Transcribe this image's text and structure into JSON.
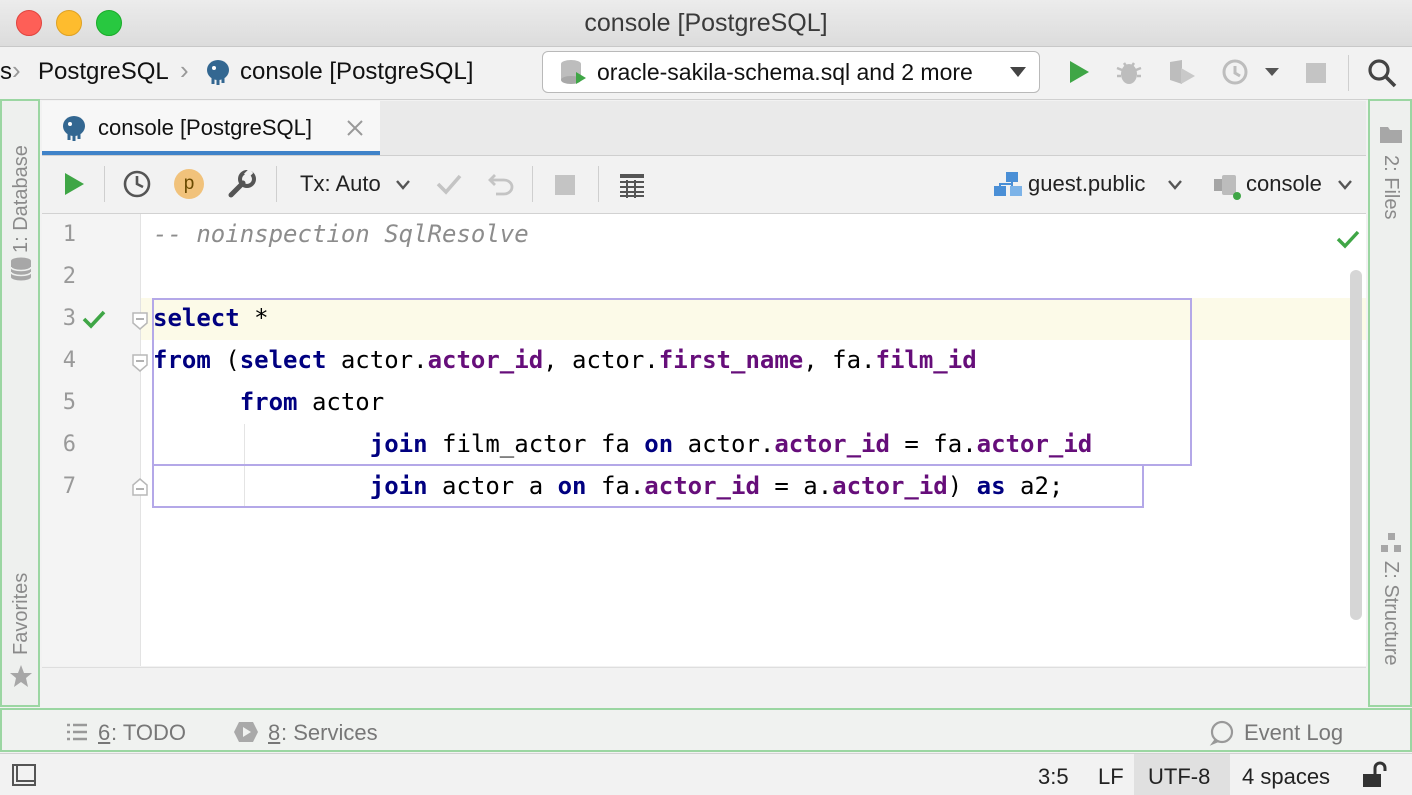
{
  "window": {
    "title": "console [PostgreSQL]"
  },
  "navbar": {
    "crumb_cut": "s",
    "crumb_db": "PostgreSQL",
    "crumb_console": "console [PostgreSQL]",
    "run_config": "oracle-sakila-schema.sql and 2 more"
  },
  "left_panel": {
    "database_label": "1: Database",
    "favorites_label": "Favorites"
  },
  "right_panel": {
    "files_label": "2: Files",
    "structure_label": "Z: Structure"
  },
  "tab": {
    "label": "console [PostgreSQL]"
  },
  "toolbar": {
    "tx_mode": "Tx: Auto",
    "p_badge": "p",
    "schema": "guest.public",
    "session": "console"
  },
  "editor": {
    "line_numbers": [
      "1",
      "2",
      "3",
      "4",
      "5",
      "6",
      "7"
    ],
    "lines": [
      [
        {
          "t": "-- noinspection SqlResolve",
          "c": "cmt"
        }
      ],
      [],
      [
        {
          "t": "select",
          "c": "kw"
        },
        {
          "t": " *",
          "c": ""
        }
      ],
      [
        {
          "t": "from",
          "c": "kw"
        },
        {
          "t": " (",
          "c": ""
        },
        {
          "t": "select",
          "c": "kw"
        },
        {
          "t": " actor.",
          "c": ""
        },
        {
          "t": "actor_id",
          "c": "fld"
        },
        {
          "t": ", actor.",
          "c": ""
        },
        {
          "t": "first_name",
          "c": "fld"
        },
        {
          "t": ", fa.",
          "c": ""
        },
        {
          "t": "film_id",
          "c": "fld"
        }
      ],
      [
        {
          "t": "      ",
          "c": ""
        },
        {
          "t": "from",
          "c": "kw"
        },
        {
          "t": " actor",
          "c": ""
        }
      ],
      [
        {
          "t": "               ",
          "c": ""
        },
        {
          "t": "join",
          "c": "kw"
        },
        {
          "t": " film_actor fa ",
          "c": ""
        },
        {
          "t": "on",
          "c": "kw"
        },
        {
          "t": " actor.",
          "c": ""
        },
        {
          "t": "actor_id",
          "c": "fld"
        },
        {
          "t": " = fa.",
          "c": ""
        },
        {
          "t": "actor_id",
          "c": "fld"
        }
      ],
      [
        {
          "t": "               ",
          "c": ""
        },
        {
          "t": "join",
          "c": "kw"
        },
        {
          "t": " actor a ",
          "c": ""
        },
        {
          "t": "on",
          "c": "kw"
        },
        {
          "t": " fa.",
          "c": ""
        },
        {
          "t": "actor_id",
          "c": "fld"
        },
        {
          "t": " = a.",
          "c": ""
        },
        {
          "t": "actor_id",
          "c": "fld"
        },
        {
          "t": ") ",
          "c": ""
        },
        {
          "t": "as",
          "c": "kw"
        },
        {
          "t": " a2;",
          "c": ""
        }
      ]
    ]
  },
  "tool_windows": {
    "todo_num": "6",
    "todo": ": TODO",
    "services_num": "8",
    "services": ": Services",
    "event_log": "Event Log"
  },
  "status": {
    "position": "3:5",
    "line_sep": "LF",
    "encoding": "UTF-8",
    "indent": "4 spaces"
  },
  "colors": {
    "accent": "#4083c9",
    "run_green": "#3fa646",
    "keyword": "#000080",
    "field": "#660e7a",
    "comment": "#8c8c8c",
    "tool_border": "#9bd6a2"
  }
}
